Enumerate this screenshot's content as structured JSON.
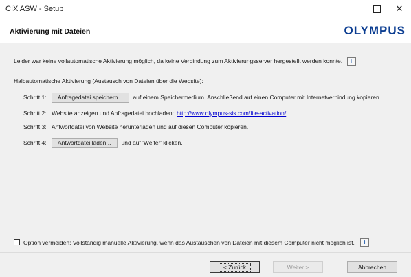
{
  "window": {
    "title": "CIX ASW - Setup",
    "minimize_glyph": "–",
    "close_glyph": "✕"
  },
  "header": {
    "title": "Aktivierung mit Dateien",
    "logo_text": "OLYMPUS"
  },
  "content": {
    "intro": "Leider war keine vollautomatische Aktivierung möglich, da keine Verbindung zum Aktivierungsserver hergestellt werden konnte.",
    "section_title": "Halbautomatische Aktivierung (Austausch von Dateien über die Website):",
    "steps": [
      {
        "label": "Schritt 1:",
        "button_label": "Anfragedatei speichern...",
        "text": "auf einem Speichermedium. Anschließend auf einen Computer mit Internetverbindung kopieren."
      },
      {
        "label": "Schritt 2:",
        "text": "Website anzeigen und Anfragedatei hochladen:",
        "link": "http://www.olympus-sis.com/file-activation/"
      },
      {
        "label": "Schritt 3:",
        "text": "Antwortdatei von Website herunterladen und auf diesen Computer kopieren."
      },
      {
        "label": "Schritt 4:",
        "button_label": "Antwortdatei laden...",
        "text": "und auf 'Weiter' klicken."
      }
    ],
    "info_glyph": "i",
    "option_checkbox_label": "Option vermeiden: Vollständig manuelle Aktivierung, wenn das Austauschen von Dateien mit diesem Computer nicht möglich ist.",
    "option_checked": false
  },
  "footer": {
    "back_label": "< Zurück",
    "next_label": "Weiter >",
    "cancel_label": "Abbrechen"
  },
  "colors": {
    "logo": "#0b3d91",
    "link": "#0000d0",
    "info_icon": "#3b6fb5"
  }
}
